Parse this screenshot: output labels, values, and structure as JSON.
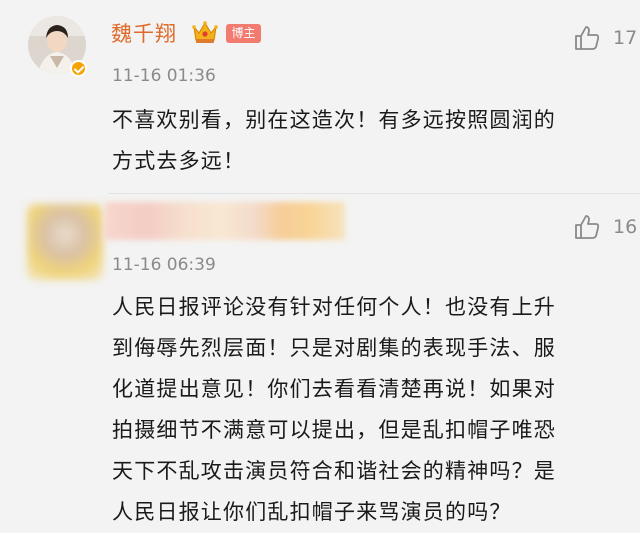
{
  "comments": [
    {
      "username": "魏千翔",
      "badge": "博主",
      "timestamp": "11-16 01:36",
      "likes": "17",
      "text_lines": [
        "不喜欢别看，别在这造次！有多远按照圆润的",
        "方式去多远！"
      ],
      "name_color": "#e06a2a"
    },
    {
      "username": "",
      "timestamp": "11-16 06:39",
      "likes": "16",
      "text_lines": [
        "人民日报评论没有针对任何个人！也没有上升",
        "到侮辱先烈层面！只是对剧集的表现手法、服",
        "化道提出意见！你们去看看清楚再说！如果对",
        "拍摄细节不满意可以提出，但是乱扣帽子唯恐",
        "天下不乱攻击演员符合和谐社会的精神吗？是",
        "人民日报让你们乱扣帽子来骂演员的吗？"
      ]
    }
  ],
  "icons": {
    "like": "thumbs-up-icon",
    "crown": "crown-icon",
    "verified": "verified-badge-icon"
  },
  "colors": {
    "background": "#f3f3f3",
    "username": "#e06a2a",
    "host_badge": "#f07b6e",
    "timestamp": "#8a8a8a",
    "verified": "#f5a300"
  }
}
